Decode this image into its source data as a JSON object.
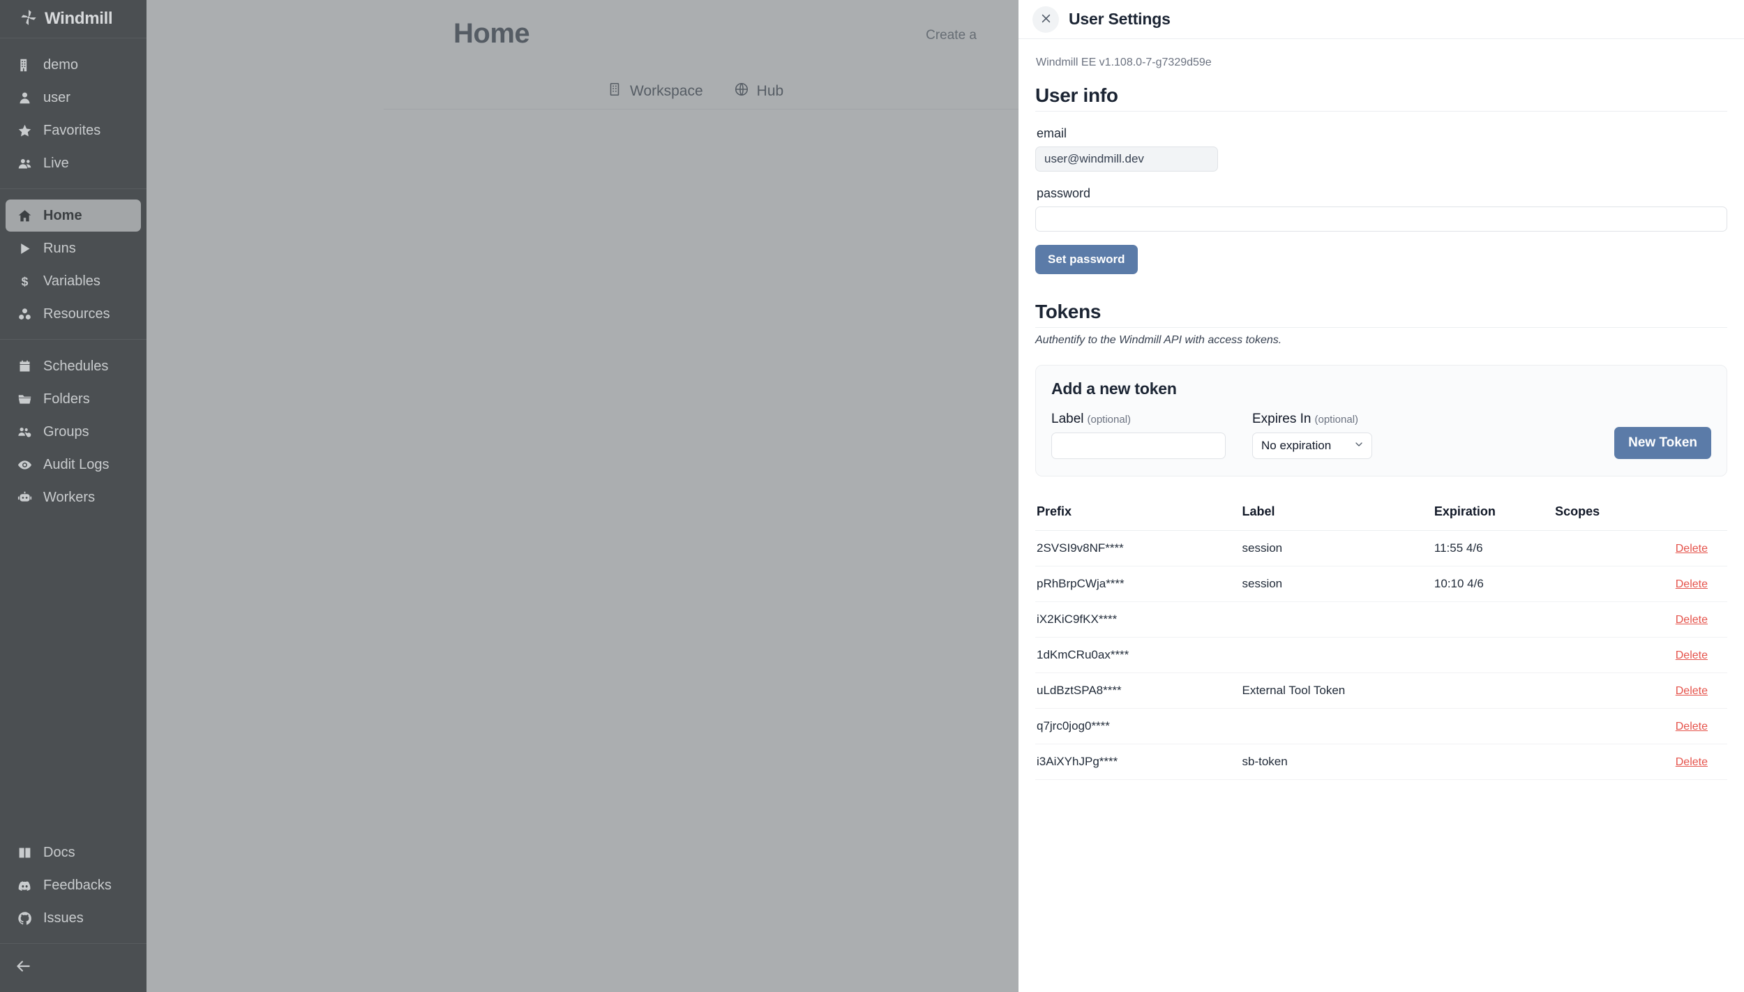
{
  "sidebar": {
    "logo_text": "Windmill",
    "groups": [
      {
        "items": [
          {
            "label": "demo",
            "icon": "building-icon"
          },
          {
            "label": "user",
            "icon": "user-icon"
          },
          {
            "label": "Favorites",
            "icon": "star-icon"
          },
          {
            "label": "Live",
            "icon": "users-icon"
          }
        ]
      },
      {
        "items": [
          {
            "label": "Home",
            "icon": "home-icon",
            "active": true
          },
          {
            "label": "Runs",
            "icon": "play-icon"
          },
          {
            "label": "Variables",
            "icon": "dollar-icon"
          },
          {
            "label": "Resources",
            "icon": "resources-icon"
          }
        ]
      },
      {
        "items": [
          {
            "label": "Schedules",
            "icon": "calendar-icon"
          },
          {
            "label": "Folders",
            "icon": "folder-icon"
          },
          {
            "label": "Groups",
            "icon": "groups-icon"
          },
          {
            "label": "Audit Logs",
            "icon": "eye-icon"
          },
          {
            "label": "Workers",
            "icon": "robot-icon"
          }
        ]
      },
      {
        "items": [
          {
            "label": "Docs",
            "icon": "book-icon"
          },
          {
            "label": "Feedbacks",
            "icon": "discord-icon"
          },
          {
            "label": "Issues",
            "icon": "github-icon"
          }
        ]
      }
    ],
    "collapse_icon": "arrow-left-icon"
  },
  "background": {
    "title": "Home",
    "create_text": "Create a",
    "tabs": [
      {
        "label": "Workspace",
        "icon": "building-icon"
      },
      {
        "label": "Hub",
        "icon": "globe-icon"
      }
    ]
  },
  "drawer": {
    "title": "User Settings",
    "close_icon": "close-icon",
    "version": "Windmill EE v1.108.0-7-g7329d59e",
    "user_info": {
      "heading": "User info",
      "email_label": "email",
      "email_value": "user@windmill.dev",
      "password_label": "password",
      "password_value": "",
      "password_placeholder": "",
      "set_password_label": "Set password"
    },
    "tokens": {
      "heading": "Tokens",
      "subtitle": "Authentify to the Windmill API with access tokens.",
      "add_card": {
        "title": "Add a new token",
        "label_label": "Label",
        "label_optional": "(optional)",
        "label_value": "",
        "expires_label": "Expires In",
        "expires_optional": "(optional)",
        "expires_value": "No expiration",
        "expires_icon": "chevron-down-icon",
        "new_token_label": "New Token"
      },
      "table": {
        "columns": [
          "Prefix",
          "Label",
          "Expiration",
          "Scopes",
          ""
        ],
        "delete_label": "Delete",
        "rows": [
          {
            "prefix": "2SVSI9v8NF****",
            "label": "session",
            "expiration": "11:55 4/6",
            "scopes": ""
          },
          {
            "prefix": "pRhBrpCWja****",
            "label": "session",
            "expiration": "10:10 4/6",
            "scopes": ""
          },
          {
            "prefix": "iX2KiC9fKX****",
            "label": "",
            "expiration": "",
            "scopes": ""
          },
          {
            "prefix": "1dKmCRu0ax****",
            "label": "",
            "expiration": "",
            "scopes": ""
          },
          {
            "prefix": "uLdBztSPA8****",
            "label": "External Tool Token",
            "expiration": "",
            "scopes": ""
          },
          {
            "prefix": "q7jrc0jog0****",
            "label": "",
            "expiration": "",
            "scopes": ""
          },
          {
            "prefix": "i3AiXYhJPg****",
            "label": "sb-token",
            "expiration": "",
            "scopes": ""
          }
        ]
      }
    }
  },
  "colors": {
    "sidebar_bg": "#4b4f52",
    "accent_blue": "#5b7ba8",
    "delete_red": "#e5534b",
    "heading": "#1b2433"
  }
}
